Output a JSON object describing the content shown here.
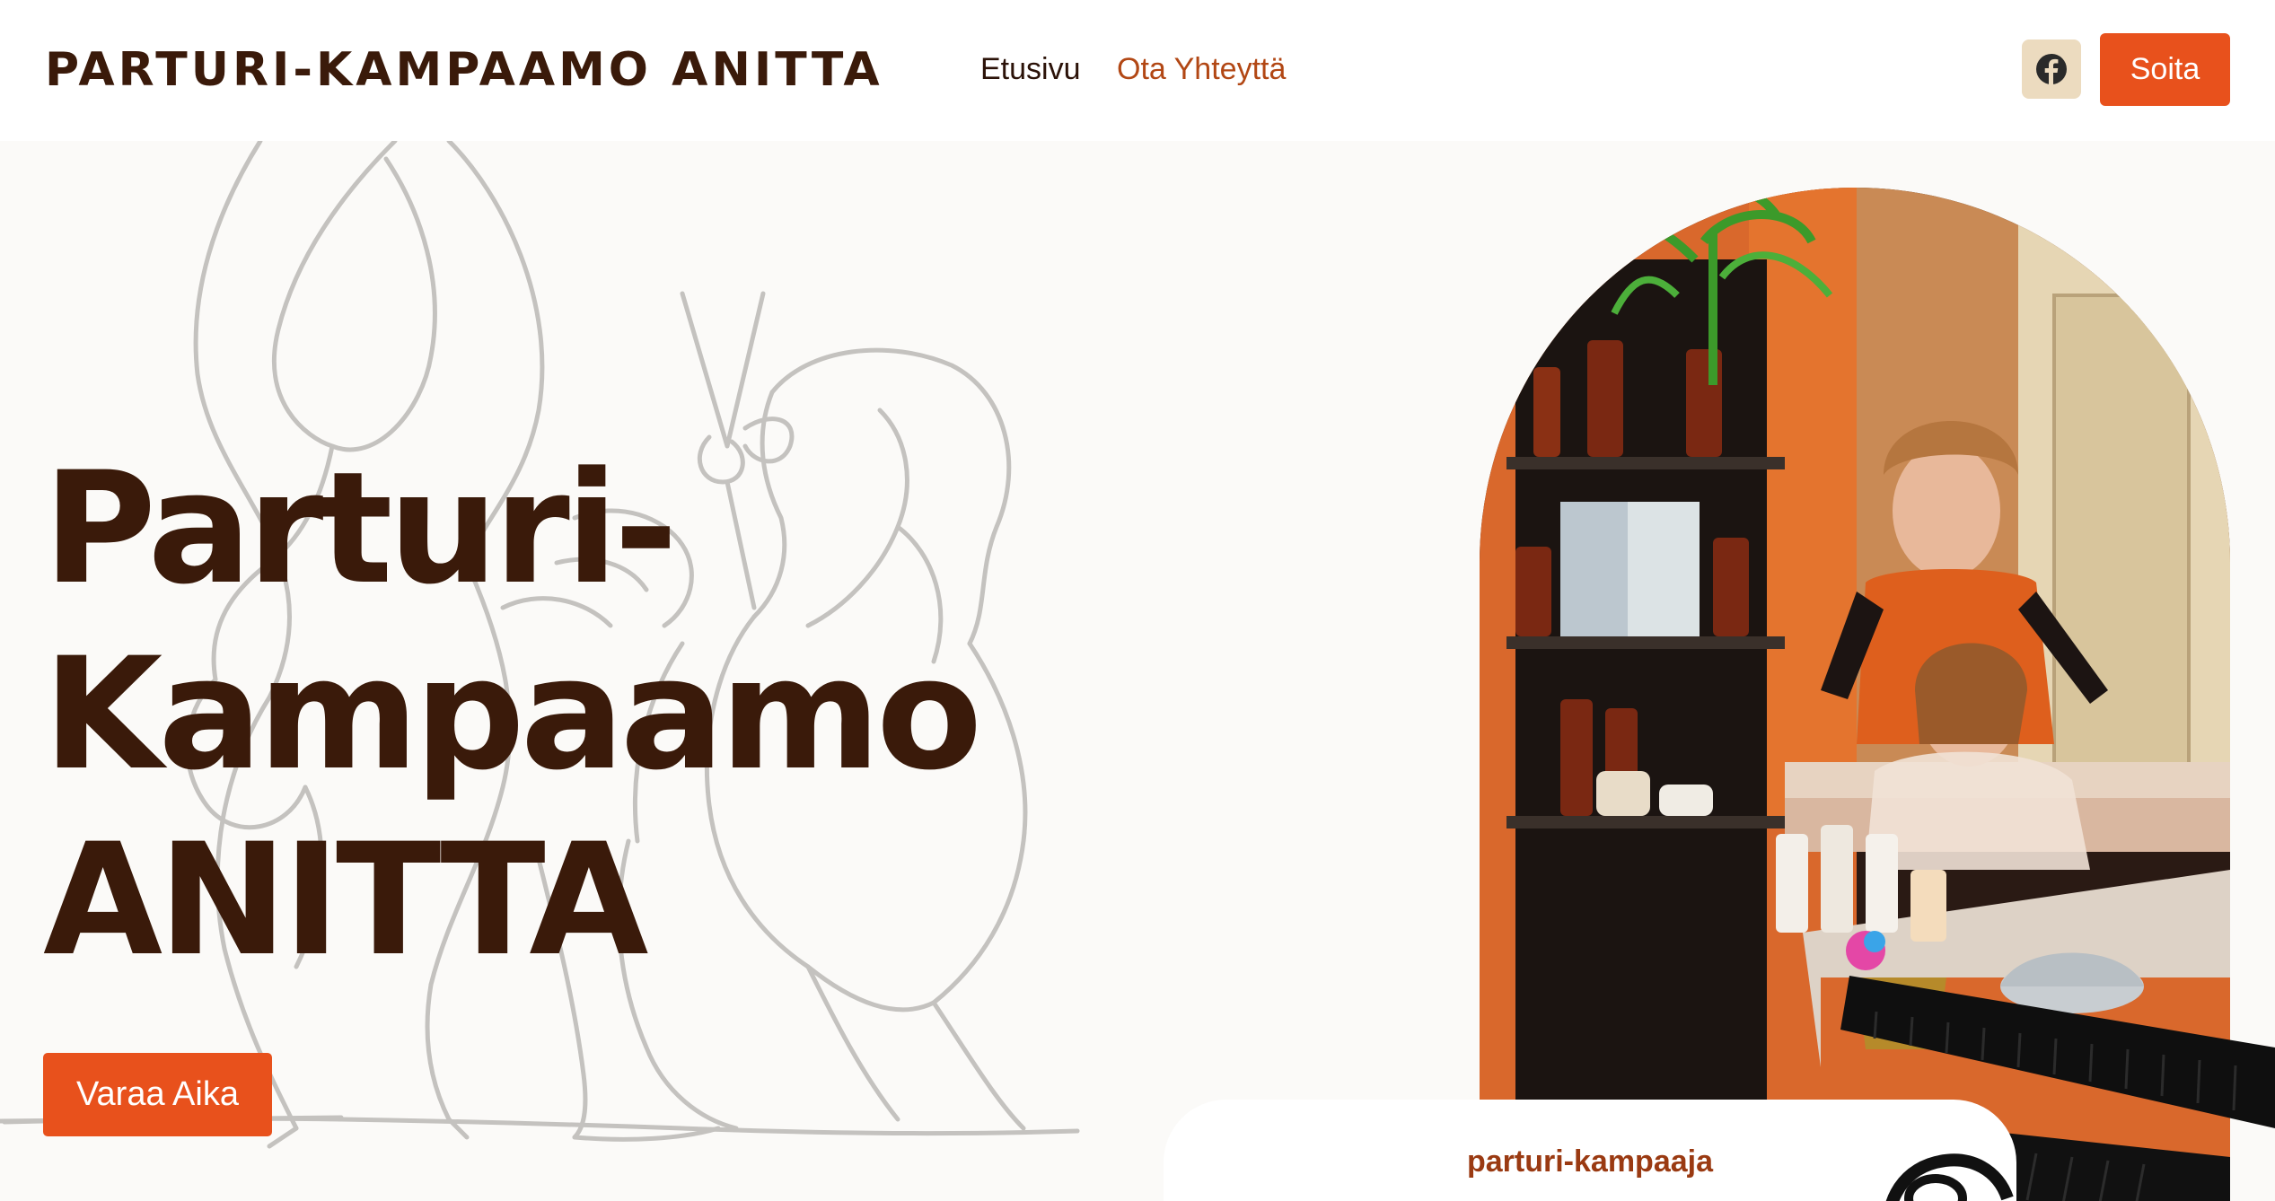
{
  "header": {
    "brand": "PARTURI-KAMPAAMO ANITTA",
    "nav": [
      {
        "label": "Etusivu",
        "active": false
      },
      {
        "label": "Ota Yhteyttä",
        "active": true
      }
    ],
    "facebook_icon": "facebook-icon",
    "call_label": "Soita"
  },
  "hero": {
    "title_lines": [
      "Parturi-",
      "Kampaamo",
      "ANITTA"
    ],
    "book_label": "Varaa Aika",
    "image_icon": "salon-photo",
    "profession_label": "parturi-kampaaja"
  },
  "colors": {
    "accent": "#e8511c",
    "brand_text": "#3a1a0a",
    "link_active": "#b24714",
    "facebook_bg": "#ecdbbf",
    "hero_bg": "#fbfaf8"
  }
}
